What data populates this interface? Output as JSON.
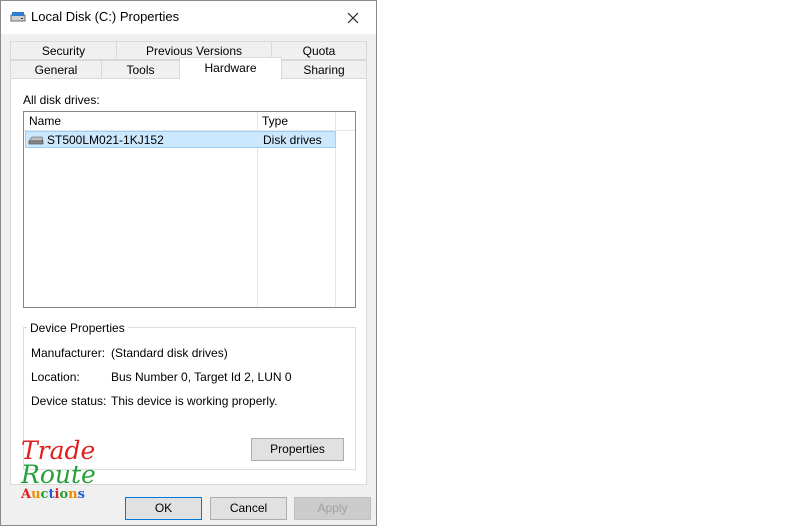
{
  "window": {
    "title": "Local Disk (C:) Properties"
  },
  "tabs": {
    "row1": [
      {
        "label": "Security"
      },
      {
        "label": "Previous Versions"
      },
      {
        "label": "Quota"
      }
    ],
    "row2": [
      {
        "label": "General"
      },
      {
        "label": "Tools"
      },
      {
        "label": "Hardware",
        "active": true
      },
      {
        "label": "Sharing"
      }
    ]
  },
  "drives": {
    "label": "All disk drives:",
    "columns": {
      "name": "Name",
      "type": "Type"
    },
    "rows": [
      {
        "name": "ST500LM021-1KJ152",
        "type": "Disk drives",
        "selected": true
      }
    ]
  },
  "device_properties": {
    "title": "Device Properties",
    "manufacturer_label": "Manufacturer:",
    "manufacturer_value": "(Standard disk drives)",
    "location_label": "Location:",
    "location_value": "Bus Number 0, Target Id 2, LUN 0",
    "status_label": "Device status:",
    "status_value": "This device is working properly.",
    "properties_button": "Properties"
  },
  "buttons": {
    "ok": "OK",
    "cancel": "Cancel",
    "apply": "Apply"
  },
  "watermark": {
    "line1": "Trade",
    "line2": "Route",
    "line3": "Auctions"
  },
  "colors": {
    "selection_bg": "#cce8ff",
    "selection_border": "#99d1ff",
    "default_button_border": "#0078d7",
    "logo_red": "#e0201f",
    "logo_green": "#27a03a"
  }
}
